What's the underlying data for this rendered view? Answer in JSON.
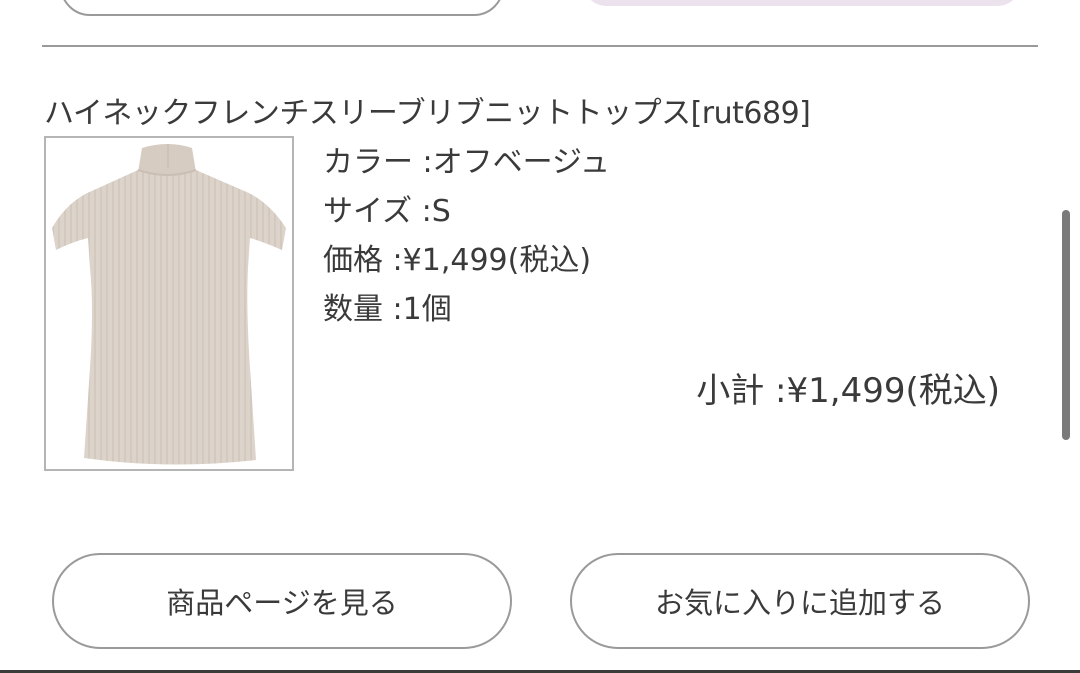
{
  "product": {
    "title": "ハイネックフレンチスリーブリブニットトップス[rut689]",
    "color_line": "カラー :オフベージュ",
    "size_line": "サイズ :S",
    "price_line": "価格 :¥1,499(税込)",
    "quantity_line": "数量 :1個",
    "subtotal_line": "小計 :¥1,499(税込)"
  },
  "actions": {
    "view_product_label": "商品ページを見る",
    "add_favorite_label": "お気に入りに追加する"
  },
  "colors": {
    "accent_top_button": "#ece2ee",
    "product_color": "#dcd2c9"
  },
  "icons": {
    "product_image": "high-neck-sleeveless-knit-top"
  }
}
